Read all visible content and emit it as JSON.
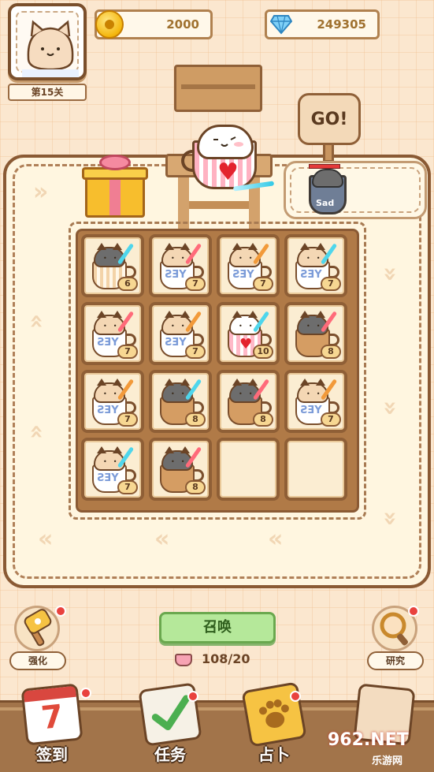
{
  "player": {
    "level_label": "第15关"
  },
  "resources": {
    "coins": "2000",
    "gems": "249305"
  },
  "hero": {
    "cup": "pink-striped-heart"
  },
  "go_sign": {
    "label": "GO!"
  },
  "enemy": {
    "cup_text": "Sad"
  },
  "grid": {
    "cells": [
      {
        "cat": "gray",
        "cup": "striped",
        "level": "6"
      },
      {
        "cat": "tan",
        "cup": "yes",
        "level": "7"
      },
      {
        "cat": "tan",
        "cup": "yes",
        "level": "7"
      },
      {
        "cat": "tan",
        "cup": "yes",
        "level": "7"
      },
      {
        "cat": "tan",
        "cup": "yes",
        "level": "7"
      },
      {
        "cat": "tan",
        "cup": "yes",
        "level": "7"
      },
      {
        "cat": "white",
        "cup": "pink",
        "level": "10"
      },
      {
        "cat": "gray",
        "cup": "brown",
        "level": "8"
      },
      {
        "cat": "tan",
        "cup": "yes",
        "level": "7"
      },
      {
        "cat": "gray",
        "cup": "brown",
        "level": "8"
      },
      {
        "cat": "gray",
        "cup": "brown",
        "level": "8"
      },
      {
        "cat": "tan",
        "cup": "yes",
        "level": "7"
      },
      {
        "cat": "tan",
        "cup": "yes",
        "level": "7"
      },
      {
        "cat": "gray",
        "cup": "brown",
        "level": "8"
      },
      {
        "cat": "",
        "cup": "",
        "level": ""
      },
      {
        "cat": "",
        "cup": "",
        "level": ""
      }
    ],
    "yes_text": "YES"
  },
  "actions": {
    "summon_label": "召唤",
    "cup_count": "108/20",
    "upgrade_label": "强化",
    "research_label": "研究"
  },
  "nav": {
    "checkin_label": "签到",
    "checkin_day": "7",
    "tasks_label": "任务",
    "divination_label": "占卜"
  },
  "watermark": {
    "brand": "962.NET",
    "site": "乐游网"
  },
  "colors": {
    "background": "#fbe7cf",
    "wood": "#8f5f36",
    "summon_green": "#b5e89a",
    "badge_red": "#e9423e"
  }
}
